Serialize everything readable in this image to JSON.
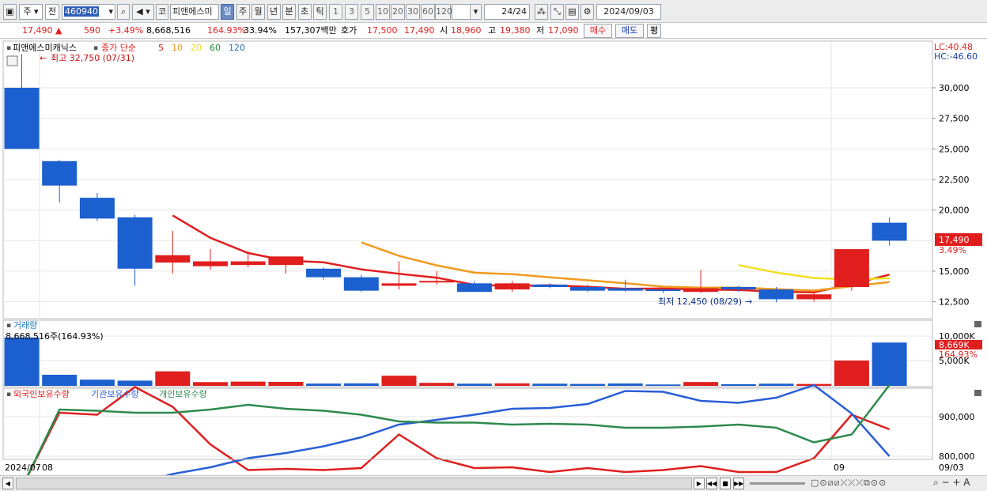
{
  "toolbar": {
    "market": "주",
    "prev_label": "전",
    "code_value": "460940",
    "market_type": "코",
    "stock_name": "피앤에스미",
    "periods": [
      "일",
      "주",
      "월",
      "년",
      "분",
      "초",
      "틱"
    ],
    "selected_period": "일",
    "intervals": [
      "1",
      "3",
      "5",
      "10",
      "20",
      "30",
      "60",
      "120"
    ],
    "count": "24",
    "count_total": "/24",
    "date": "2024/09/03"
  },
  "quote": {
    "price": "17,490",
    "arrow": "▲",
    "change": "590",
    "change_pct": "+3.49%",
    "volume": "8,668,516",
    "volume_ratio": "164.93%",
    "turnover": "33.94%",
    "amount": "157,307백만",
    "bid_ask_label": "호가",
    "ask": "17,500",
    "bid": "17,490",
    "open_label": "시",
    "open": "18,960",
    "high_label": "고",
    "high": "19,380",
    "low_label": "저",
    "low": "17,090",
    "buy_label": "매수",
    "sell_label": "매도",
    "eval_label": "평"
  },
  "price_panel": {
    "title": "피앤에스미캐닉스",
    "legend_prefix": "종가 단순",
    "ma_legend": [
      {
        "label": "5",
        "color": "#e01e1e"
      },
      {
        "label": "10",
        "color": "#f09a1e"
      },
      {
        "label": "20",
        "color": "#e8e020"
      },
      {
        "label": "60",
        "color": "#1e8a3a"
      },
      {
        "label": "120",
        "color": "#2a6ebd"
      }
    ],
    "high_note": "최고 32,750 (07/31)",
    "low_note": "최저 12,450 (08/29)",
    "lc": "LC:40.48",
    "hc": "HC:-46.60",
    "last_price_tag": "17,490",
    "last_pct_tag": "3.49%",
    "yticks": [
      "30,000",
      "27,500",
      "25,000",
      "22,500",
      "20,000",
      "15,000",
      "12,500"
    ]
  },
  "volume_panel": {
    "title": "거래량",
    "value_text": "8,668,516주(164.93%)",
    "yticks": [
      "10,000K",
      "5,000K"
    ],
    "last_tag": "8,669K",
    "last_pct": "164.93%"
  },
  "holdings_panel": {
    "legend": [
      {
        "label": "외국인보유수량",
        "color": "#e01e1e"
      },
      {
        "label": "기관보유수량",
        "color": "#2a5ed6"
      },
      {
        "label": "개인보유수량",
        "color": "#2e8a4e"
      }
    ],
    "yticks": [
      "900,000",
      "800,000"
    ]
  },
  "xaxis": {
    "labels": [
      "2024/07",
      "08",
      "09"
    ],
    "right_date": "09/03"
  },
  "chart_data": {
    "type": "candlestick",
    "dates_note": "daily, 2024/07/31 – 2024/09/03",
    "ohlc": [
      [
        30000,
        32750,
        25000,
        25000
      ],
      [
        24000,
        24100,
        20600,
        22000
      ],
      [
        21000,
        21400,
        19100,
        19300
      ],
      [
        19400,
        19600,
        13800,
        15200
      ],
      [
        15700,
        18300,
        14800,
        16300
      ],
      [
        15400,
        16800,
        15100,
        15800
      ],
      [
        15500,
        16600,
        15300,
        15800
      ],
      [
        15500,
        16200,
        14800,
        16200
      ],
      [
        15200,
        15300,
        14300,
        14500
      ],
      [
        14500,
        14700,
        13300,
        13400
      ],
      [
        13800,
        15800,
        13500,
        14000
      ],
      [
        14100,
        15000,
        13900,
        14200
      ],
      [
        14000,
        14200,
        13300,
        13300
      ],
      [
        13500,
        14200,
        13300,
        14000
      ],
      [
        13900,
        14000,
        13600,
        13700
      ],
      [
        13700,
        13900,
        13300,
        13400
      ],
      [
        13600,
        14300,
        13300,
        13400
      ],
      [
        13500,
        13600,
        13200,
        13400
      ],
      [
        13300,
        15100,
        13200,
        13600
      ],
      [
        13700,
        13800,
        13300,
        13500
      ],
      [
        13500,
        13700,
        12450,
        12700
      ],
      [
        12700,
        13300,
        12500,
        13100
      ],
      [
        13700,
        16800,
        13400,
        16800
      ],
      [
        18960,
        19380,
        17090,
        17490
      ]
    ],
    "volume_k": [
      9700,
      2100,
      1100,
      900,
      2800,
      600,
      700,
      650,
      300,
      350,
      1900,
      450,
      280,
      350,
      280,
      230,
      320,
      120,
      620,
      180,
      280,
      220,
      5000,
      8669
    ],
    "foreign": [
      720000,
      910000,
      905000,
      975000,
      925000,
      830000,
      765000,
      768000,
      765000,
      770000,
      855000,
      795000,
      770000,
      772000,
      760000,
      770000,
      760000,
      765000,
      775000,
      760000,
      760000,
      795000,
      905000,
      868000
    ],
    "institution": [
      722000,
      722000,
      726000,
      728000,
      755000,
      772000,
      795000,
      808000,
      825000,
      848000,
      880000,
      892000,
      905000,
      920000,
      922000,
      932000,
      965000,
      963000,
      940000,
      935000,
      948000,
      980000,
      908000,
      800000
    ],
    "individual": [
      720000,
      918000,
      915000,
      910000,
      910000,
      918000,
      930000,
      920000,
      915000,
      905000,
      888000,
      885000,
      885000,
      880000,
      882000,
      880000,
      872000,
      872000,
      875000,
      880000,
      872000,
      835000,
      855000,
      980000
    ],
    "ma5_start_index": 4,
    "ma10_start_index": 9,
    "ma20_start_index": 19,
    "up_color": "#e01e1e",
    "down_color": "#1c5fcf"
  }
}
